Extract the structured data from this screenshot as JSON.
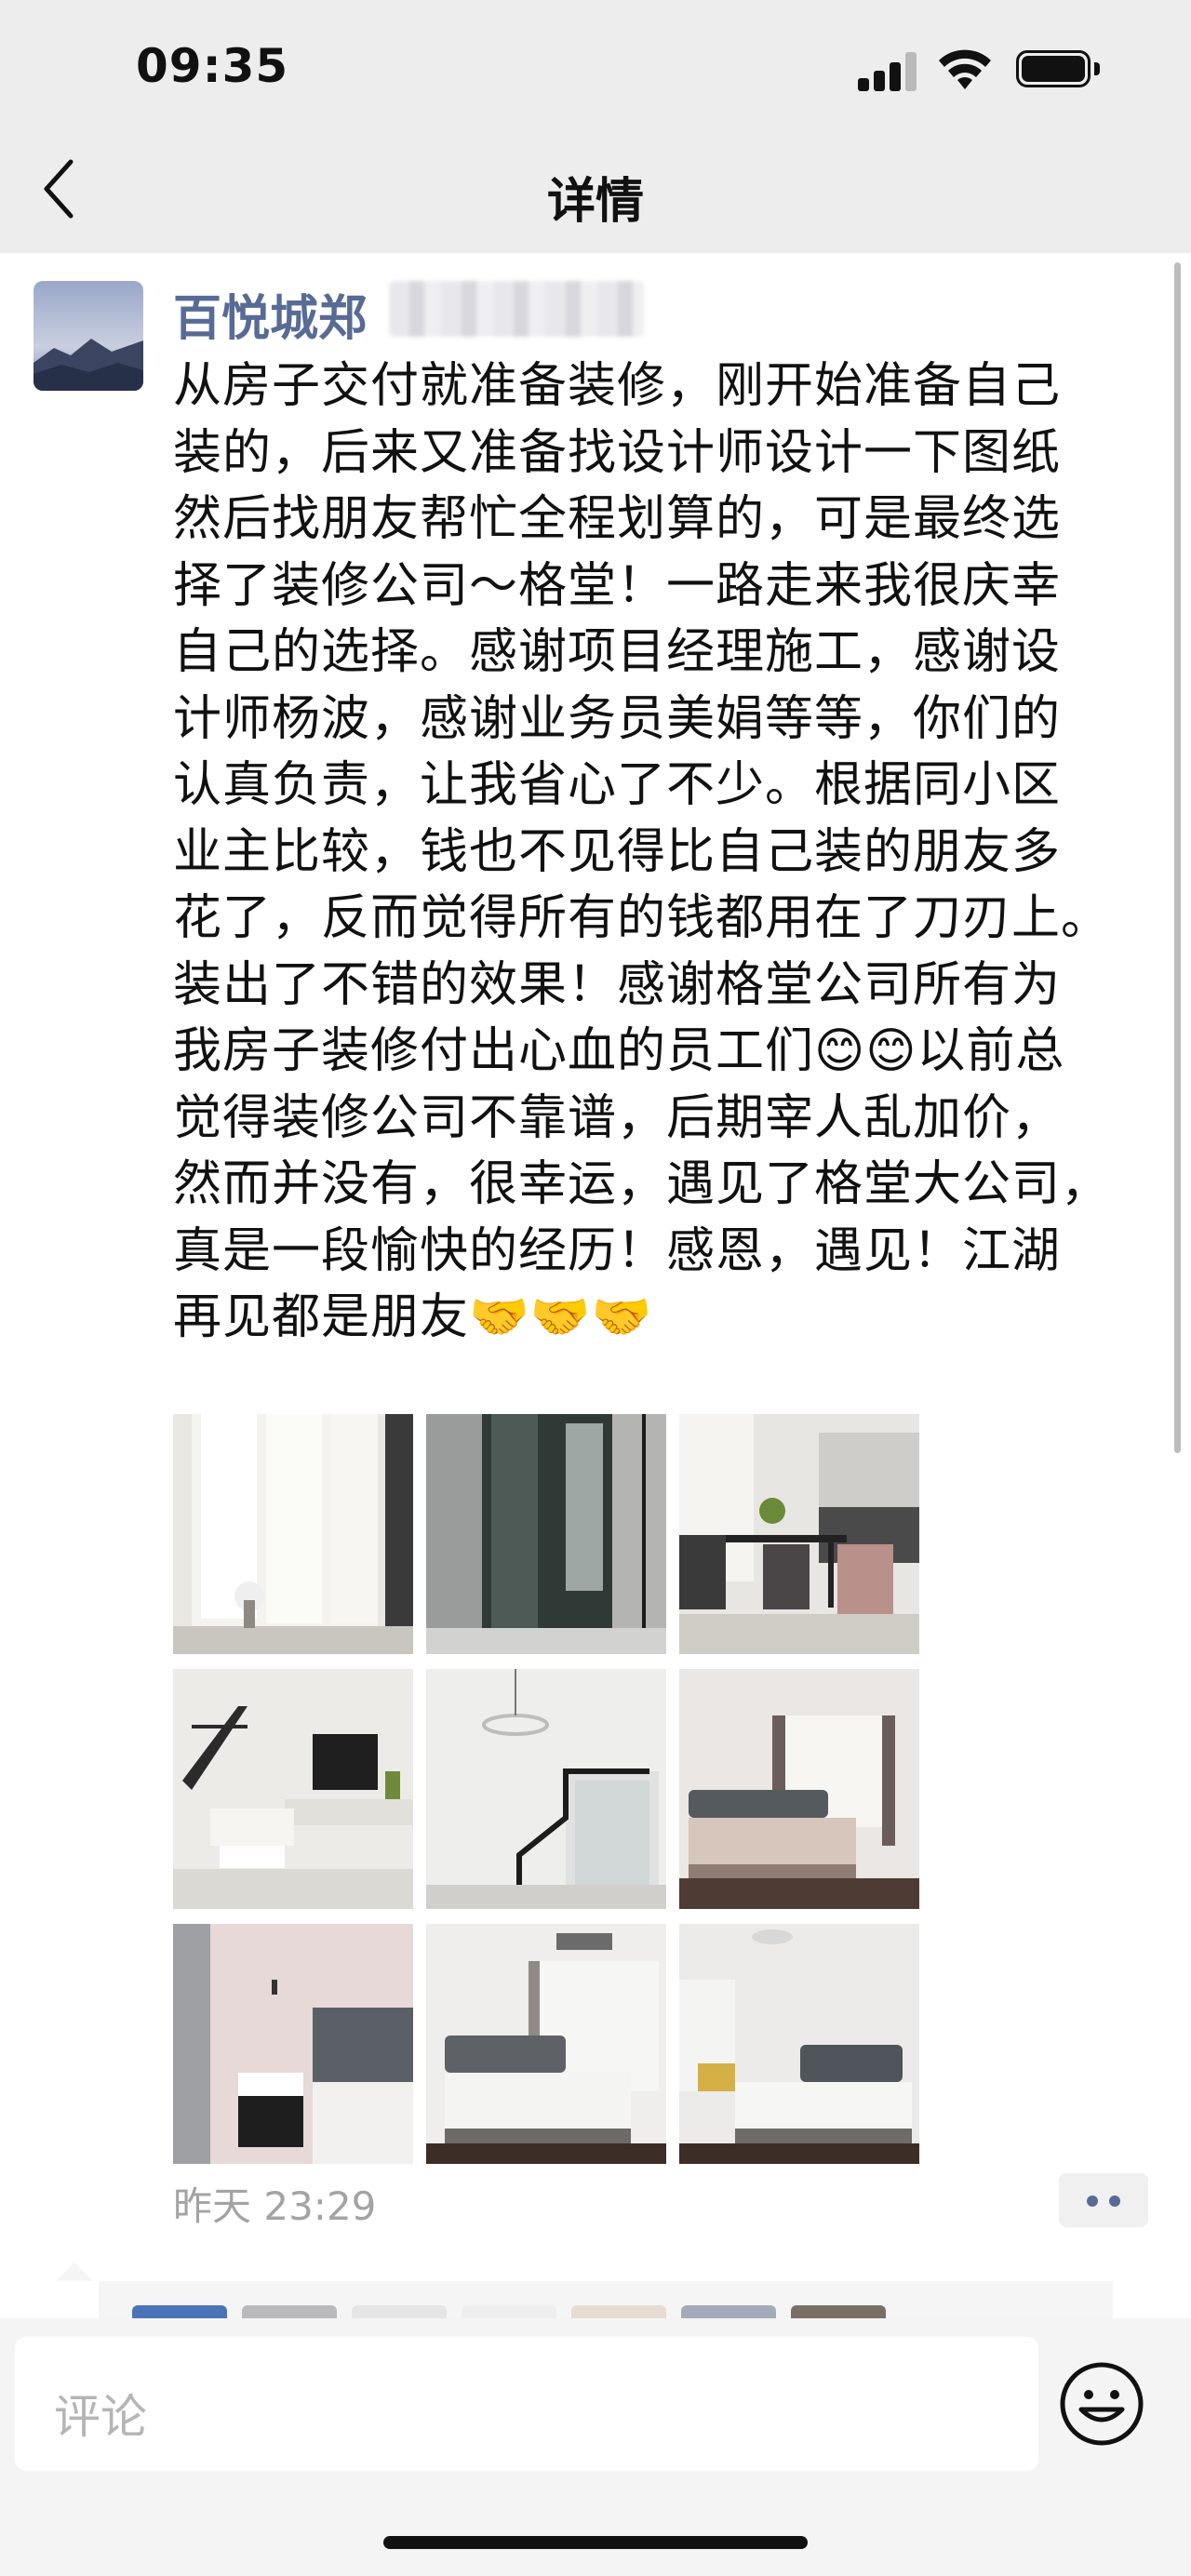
{
  "status_bar": {
    "time": "09:35"
  },
  "nav": {
    "title": "详情"
  },
  "post": {
    "author": "百悦城郑",
    "text": "从房子交付就准备装修，刚开始准备自己\n装的，后来又准备找设计师设计一下图纸\n然后找朋友帮忙全程划算的，可是最终选\n择了装修公司～格堂！一路走来我很庆幸\n自己的选择。感谢项目经理施工，感谢设\n计师杨波，感谢业务员美娟等等，你们的\n认真负责，让我省心了不少。根据同小区\n业主比较，钱也不见得比自己装的朋友多\n花了，反而觉得所有的钱都用在了刀刃上。\n装出了不错的效果！感谢格堂公司所有为\n我房子装修付出心血的员工们😊😊以前总\n觉得装修公司不靠谱，后期宰人乱加价，\n然而并没有，很幸运，遇见了格堂大公司，\n真是一段愉快的经历！感恩，遇见！江湖\n再见都是朋友🤝🤝🤝",
    "timestamp": "昨天 23:29",
    "photos": [
      "living-room-curtains-photo",
      "bathroom-glass-door-photo",
      "dining-room-photo",
      "staircase-living-room-photo",
      "staircase-glass-railing-photo",
      "bedroom-window-photo",
      "bedroom-pink-wall-photo",
      "bedroom-grey-headboard-photo",
      "bedroom-chandelier-photo"
    ]
  },
  "comment": {
    "placeholder": "评论"
  },
  "colors": {
    "author": "#576b95",
    "nav_bg": "#ededed",
    "timestamp": "#a3a3a3"
  }
}
